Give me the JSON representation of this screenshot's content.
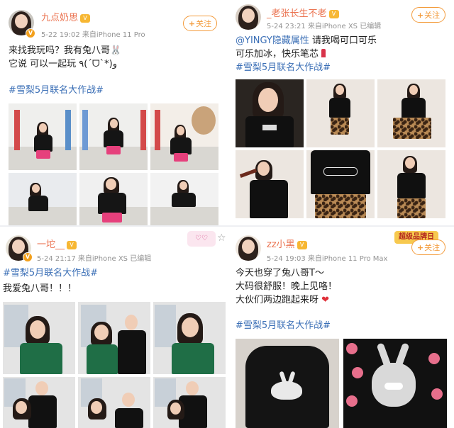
{
  "colors": {
    "username": "#eb7350",
    "topic_link": "#3b6fb6",
    "follow": "#f39b3b",
    "meta": "#939393",
    "heart": "#e0313a"
  },
  "posts": [
    {
      "username": "九点奶思",
      "time": "5-22 19:02",
      "source": "来自iPhone 11 Pro",
      "follow_label": "关注",
      "lines": [
        "来找我玩吗？我有兔八哥🐰",
        " 它说 可以一起玩 ٩(ˊᗜˋ*)و"
      ],
      "topic": "#雪梨5月联名大作战#",
      "photo_count": 6
    },
    {
      "username": "_老张长生不老",
      "time": "5-24 23:21",
      "source": "来自iPhone XS",
      "edited": "已编辑",
      "follow_label": "关注",
      "mention": "@YINGY隐藏属性",
      "line1_rest": " 请我喝可口可乐",
      "line2": "可乐加冰，快乐笔芯",
      "line2_icon": "lipstick-icon",
      "topic": "#雪梨5月联名大作战#",
      "photo_count": 6
    },
    {
      "username": "一坨__",
      "time": "5-24 21:17",
      "source": "来自iPhone XS",
      "edited": "已编辑",
      "lines": [
        "我爱兔八哥！！！"
      ],
      "topic": "#雪梨5月联名大作战#",
      "sticker": "♡♡",
      "photo_count": 6
    },
    {
      "username": "zz小黑",
      "time": "5-24 19:03",
      "source": "来自iPhone 11 Pro Max",
      "follow_label": "关注",
      "promo_badge": "超级品牌日",
      "lines": [
        "今天也穿了兔八哥T～",
        "大码很舒服！晚上见咯！",
        "大伙们两边跑起来呀"
      ],
      "heart": "❤",
      "topic": "#雪梨5月联名大作战#",
      "photo_count": 2
    }
  ]
}
